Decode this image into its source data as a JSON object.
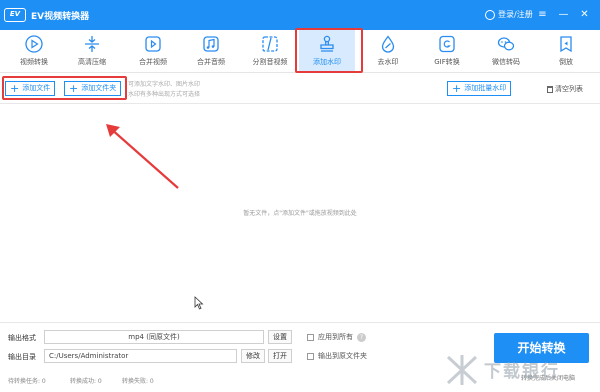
{
  "app": {
    "logo_text": "EV",
    "title": "EV视频转换器",
    "login_label": "登录/注册"
  },
  "window_controls": {
    "menu": "≡",
    "minimize": "—",
    "close": "✕"
  },
  "toolbar": {
    "items": [
      {
        "label": "视频转换",
        "icon": "video-convert-icon"
      },
      {
        "label": "高清压缩",
        "icon": "compress-icon"
      },
      {
        "label": "合并视频",
        "icon": "merge-video-icon"
      },
      {
        "label": "合并音频",
        "icon": "merge-audio-icon"
      },
      {
        "label": "分割音视频",
        "icon": "split-icon"
      },
      {
        "label": "添加水印",
        "icon": "stamp-icon",
        "active": true
      },
      {
        "label": "去水印",
        "icon": "drop-icon"
      },
      {
        "label": "GIF转换",
        "icon": "gif-icon"
      },
      {
        "label": "微信转码",
        "icon": "wechat-icon"
      },
      {
        "label": "倒放",
        "icon": "rewind-icon"
      }
    ]
  },
  "actions": {
    "add_file": "添加文件",
    "add_folder": "添加文件夹",
    "hint_line1": "可添加文字水印、图片水印",
    "hint_line2": "水印有多种出现方式可选择",
    "add_batch_watermark": "添加批量水印",
    "clear_list": "清空列表"
  },
  "empty_message": "暂无文件，点\"添加文件\"或拖放视频到此处",
  "bottom": {
    "output_format_label": "输出格式",
    "output_format_value": "mp4 (同原文件)",
    "settings_button": "设置",
    "apply_all_label": "应用到所有",
    "help_mark": "?",
    "output_dir_label": "输出目录",
    "output_dir_value": "C:/Users/Administrator",
    "modify_button": "修改",
    "open_button": "打开",
    "output_to_source_label": "输出到原文件夹",
    "start_button": "开始转换",
    "start_note": "转换完成后关闭电脑",
    "status": {
      "pending": "待转换任务: 0",
      "success": "转换成功: 0",
      "failed": "转换失败: 0"
    }
  },
  "watermark_brand": "下载银行",
  "colors": {
    "accent": "#1e8ff5",
    "highlight": "#e53b3b",
    "active_bg": "#d8eafd"
  }
}
